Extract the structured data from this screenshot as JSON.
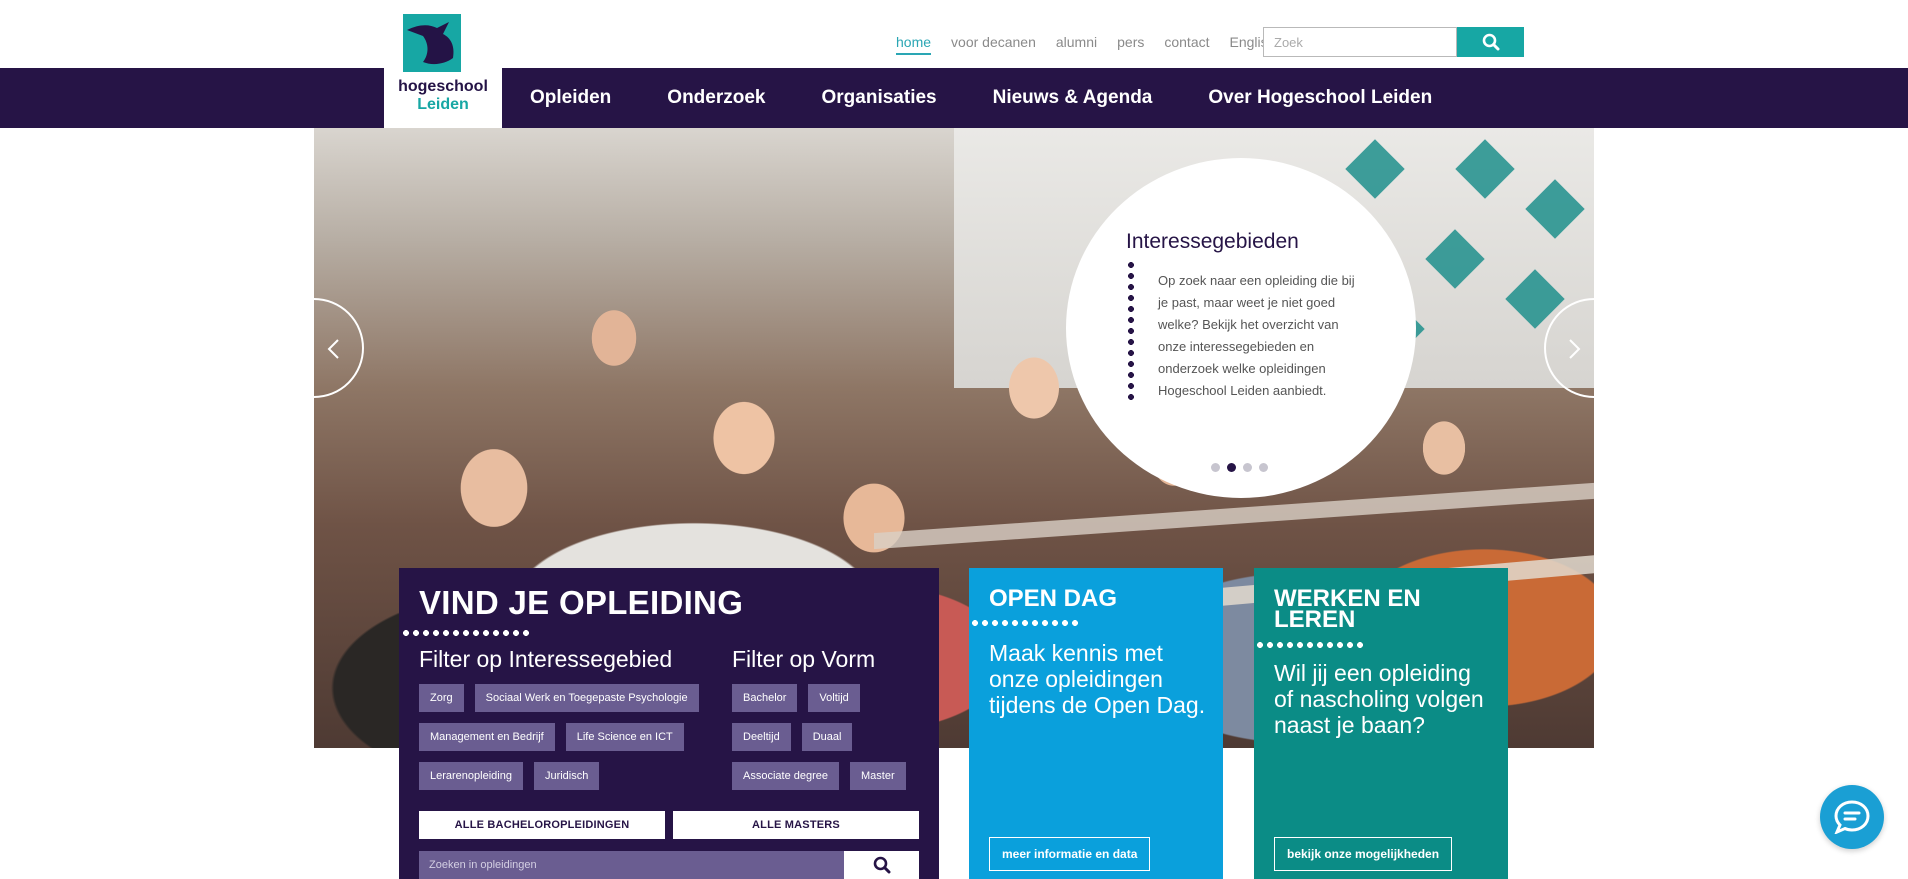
{
  "topnav": {
    "links": [
      {
        "label": "home",
        "active": true
      },
      {
        "label": "voor decanen",
        "active": false
      },
      {
        "label": "alumni",
        "active": false
      },
      {
        "label": "pers",
        "active": false
      },
      {
        "label": "contact",
        "active": false
      },
      {
        "label": "English",
        "active": false
      }
    ],
    "search_placeholder": "Zoek"
  },
  "logo": {
    "line1": "hogeschool",
    "line2": "Leiden"
  },
  "mainnav": {
    "items": [
      "Opleiden",
      "Onderzoek",
      "Organisaties",
      "Nieuws & Agenda",
      "Over Hogeschool Leiden"
    ]
  },
  "hero": {
    "title": "Interessegebieden",
    "text": "Op zoek naar een opleiding die bij je past, maar weet je niet goed welke? Bekijk het overzicht van onze interessegebieden en onderzoek welke opleidingen Hogeschool Leiden aanbiedt.",
    "pager": {
      "count": 4,
      "active": 2
    }
  },
  "vind": {
    "title": "VIND JE OPLEIDING",
    "filter1_title": "Filter op Interessegebied",
    "filter1_tags": [
      "Zorg",
      "Sociaal Werk en Toegepaste Psychologie",
      "Management en Bedrijf",
      "Life Science en ICT",
      "Lerarenopleiding",
      "Juridisch"
    ],
    "filter2_title": "Filter op Vorm",
    "filter2_tags": [
      "Bachelor",
      "Voltijd",
      "Deeltijd",
      "Duaal",
      "Associate degree",
      "Master"
    ],
    "btn_bachelor": "ALLE BACHELOROPLEIDINGEN",
    "btn_master": "ALLE MASTERS",
    "search_placeholder": "Zoeken in opleidingen"
  },
  "open_dag": {
    "title": "OPEN DAG",
    "text": "Maak kennis met onze opleidingen tijdens de Open Dag.",
    "button": "meer informatie en data"
  },
  "werken": {
    "title_line1": "WERKEN EN",
    "title_line2": "LEREN",
    "text": "Wil jij een opleiding of nascholing volgen naast je baan?",
    "button": "bekijk onze mogelijkheden"
  },
  "colors": {
    "brand_dark": "#261446",
    "teal": "#17a7a4",
    "blue": "#0aa0dc",
    "green": "#0b8c86"
  }
}
